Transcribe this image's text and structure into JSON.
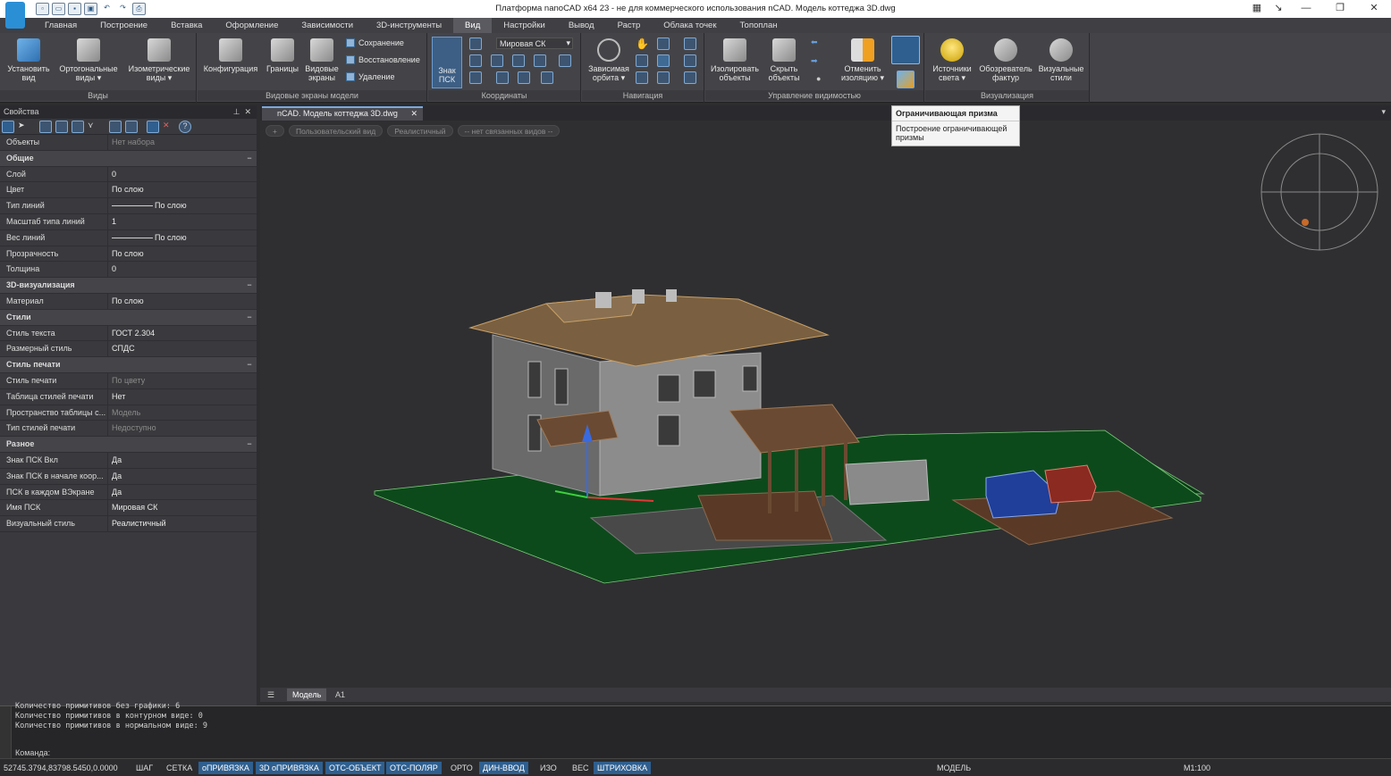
{
  "window": {
    "title": "Платформа nanoCAD x64 23 - не для коммерческого использования nCAD. Модель коттеджа 3D.dwg"
  },
  "menu": [
    "Главная",
    "Построение",
    "Вставка",
    "Оформление",
    "Зависимости",
    "3D-инструменты",
    "Вид",
    "Настройки",
    "Вывод",
    "Растр",
    "Облака точек",
    "Топоплан"
  ],
  "menu_active": "Вид",
  "ribbon": {
    "views": {
      "label": "Виды",
      "items": [
        "Установить вид",
        "Ортогональные виды ▾",
        "Изометрические виды ▾"
      ]
    },
    "viewports": {
      "label": "Видовые экраны модели",
      "items": [
        "Конфигурация",
        "Границы",
        "Видовые экраны"
      ],
      "small": [
        "Сохранение",
        "Восстановление",
        "Удаление"
      ]
    },
    "coords": {
      "label": "Координаты",
      "big": "Знак ПСК",
      "ucs": "Мировая СК"
    },
    "nav": {
      "label": "Навигация",
      "big": "Зависимая орбита ▾"
    },
    "visibility": {
      "label": "Управление видимостью",
      "items": [
        "Изолировать объекты",
        "Скрыть объекты",
        "Отменить изоляцию ▾"
      ]
    },
    "viz": {
      "label": "Визуализация",
      "items": [
        "Источники света ▾",
        "Обозреватель фактур",
        "Визуальные стили"
      ]
    }
  },
  "tooltip": {
    "title": "Ограничивающая призма",
    "body": "Построение ограничивающей призмы"
  },
  "properties": {
    "title": "Свойства",
    "rows": [
      {
        "k": "Объекты",
        "v": "Нет набора",
        "dim": true
      },
      {
        "sec": "Общие"
      },
      {
        "k": "Слой",
        "v": "0"
      },
      {
        "k": "Цвет",
        "v": "По слою"
      },
      {
        "k": "Тип линий",
        "v": "По слою",
        "line": true
      },
      {
        "k": "Масштаб типа линий",
        "v": "1"
      },
      {
        "k": "Вес линий",
        "v": "По слою",
        "line": true
      },
      {
        "k": "Прозрачность",
        "v": "По слою"
      },
      {
        "k": "Толщина",
        "v": "0"
      },
      {
        "sec": "3D-визуализация"
      },
      {
        "k": "Материал",
        "v": "По слою"
      },
      {
        "sec": "Стили"
      },
      {
        "k": "Стиль текста",
        "v": "ГОСТ 2.304"
      },
      {
        "k": "Размерный стиль",
        "v": "СПДС"
      },
      {
        "sec": "Стиль печати"
      },
      {
        "k": "Стиль печати",
        "v": "По цвету",
        "dim": true
      },
      {
        "k": "Таблица стилей печати",
        "v": "Нет"
      },
      {
        "k": "Пространство таблицы с...",
        "v": "Модель",
        "dim": true
      },
      {
        "k": "Тип стилей печати",
        "v": "Недоступно",
        "dim": true
      },
      {
        "sec": "Разное"
      },
      {
        "k": "Знак ПСК Вкл",
        "v": "Да"
      },
      {
        "k": "Знак ПСК в начале коор...",
        "v": "Да"
      },
      {
        "k": "ПСК в каждом ВЭкране",
        "v": "Да"
      },
      {
        "k": "Имя ПСК",
        "v": "Мировая СК"
      },
      {
        "k": "Визуальный стиль",
        "v": "Реалистичный"
      }
    ]
  },
  "doc_tab": "nCAD. Модель коттеджа 3D.dwg",
  "viewport_bar": [
    "+",
    "Пользовательский вид",
    "Реалистичный",
    "-- нет связанных видов --"
  ],
  "model_tabs": [
    "Модель",
    "A1"
  ],
  "command": {
    "lines": [
      "Количество примитивов без графики: 6",
      "Количество примитивов в контурном виде: 0",
      "Количество примитивов в нормальном виде: 9"
    ],
    "prompt": "Команда:"
  },
  "status": {
    "coords": "52745.3794,83798.5450,0.0000",
    "toggles": [
      {
        "label": "ШАГ",
        "on": false
      },
      {
        "label": "СЕТКА",
        "on": false
      },
      {
        "label": "оПРИВЯЗКА",
        "on": true
      },
      {
        "label": "3D оПРИВЯЗКА",
        "on": true
      },
      {
        "label": "ОТС-ОБЪЕКТ",
        "on": true
      },
      {
        "label": "ОТС-ПОЛЯР",
        "on": true
      },
      {
        "label": "ОРТО",
        "on": false
      },
      {
        "label": "ДИН-ВВОД",
        "on": true
      },
      {
        "label": "ИЗО",
        "on": false
      },
      {
        "label": "ВЕС",
        "on": false
      },
      {
        "label": "ШТРИХОВКА",
        "on": true
      }
    ],
    "space": "МОДЕЛЬ",
    "scale": "М1:100"
  }
}
